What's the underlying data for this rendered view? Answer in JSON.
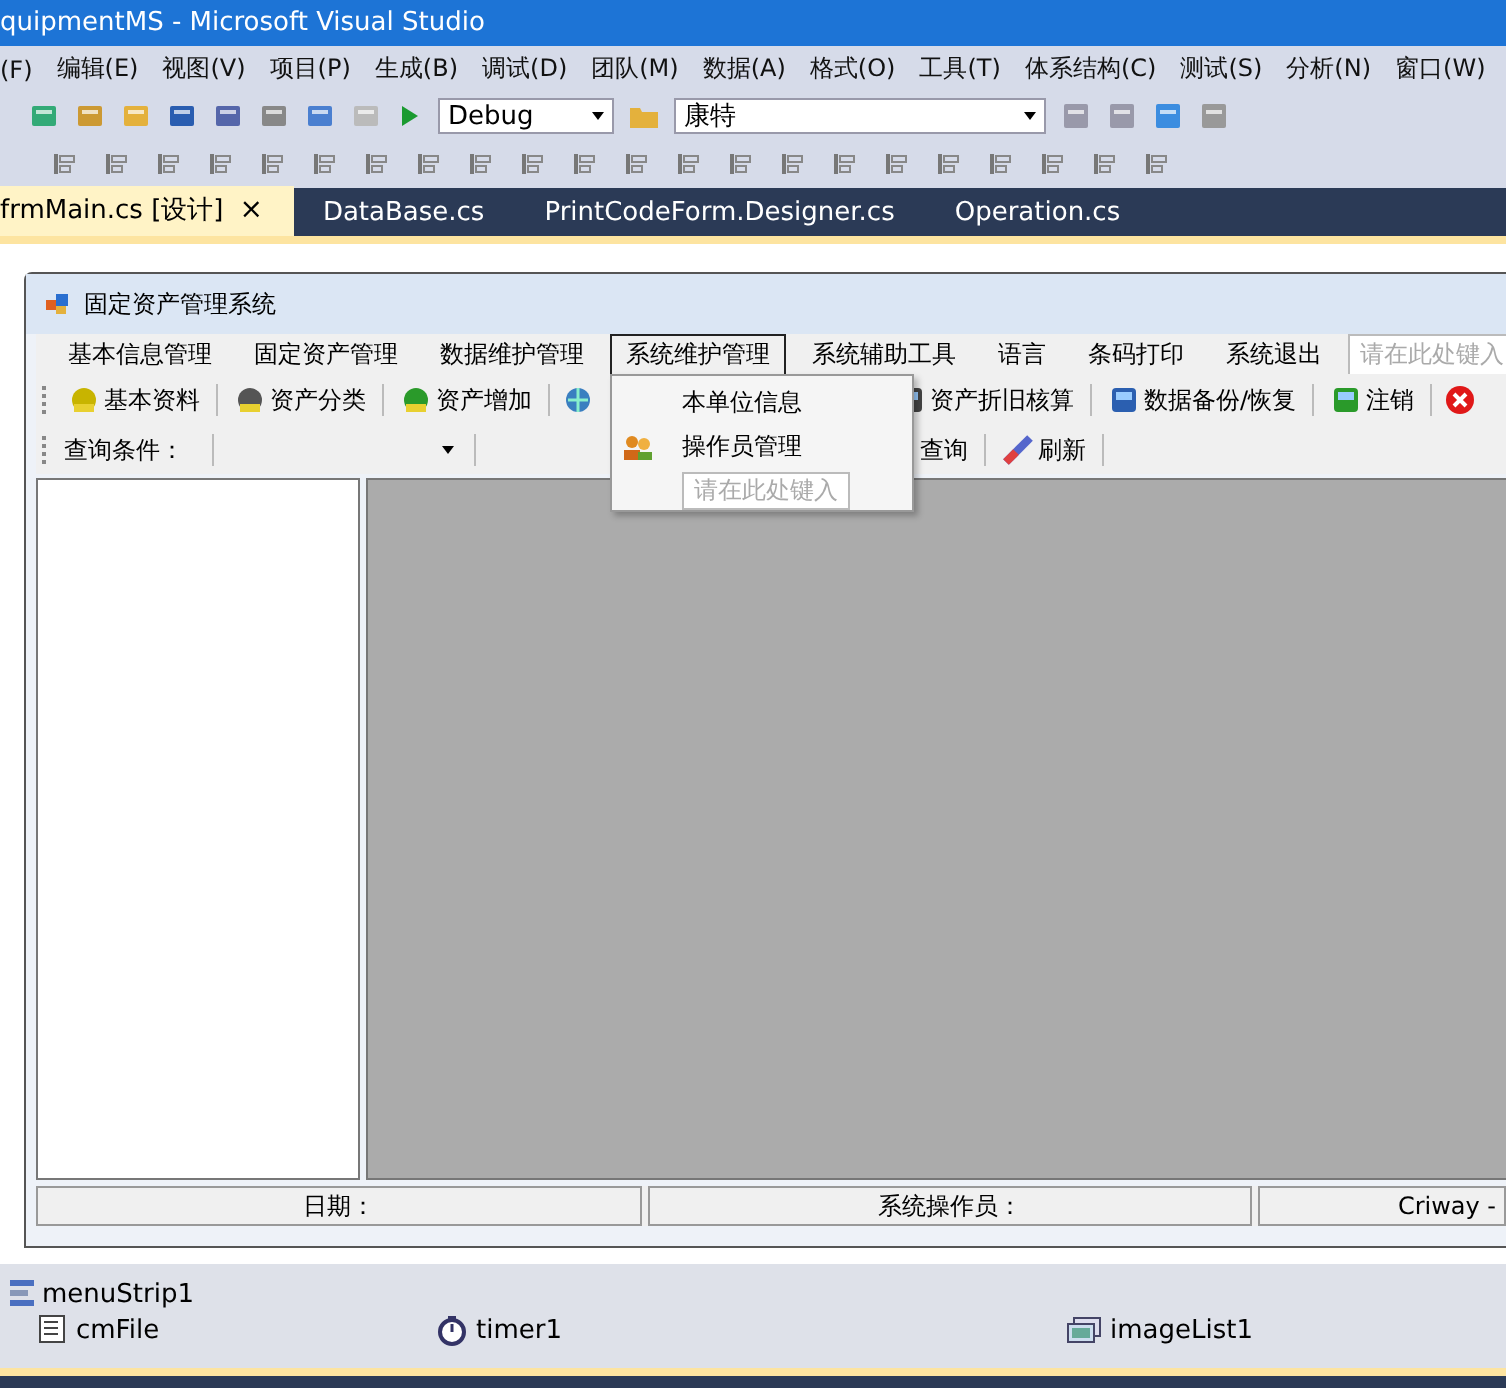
{
  "window": {
    "title": "quipmentMS - Microsoft Visual Studio"
  },
  "menu": [
    "(F)",
    "编辑(E)",
    "视图(V)",
    "项目(P)",
    "生成(B)",
    "调试(D)",
    "团队(M)",
    "数据(A)",
    "格式(O)",
    "工具(T)",
    "体系结构(C)",
    "测试(S)",
    "分析(N)",
    "窗口(W)"
  ],
  "toolbar": {
    "config_combo": "Debug",
    "project_combo": "康特"
  },
  "tabs": [
    {
      "label": "frmMain.cs [设计]",
      "selected": true,
      "close": "×"
    },
    {
      "label": "DataBase.cs",
      "selected": false
    },
    {
      "label": "PrintCodeForm.Designer.cs",
      "selected": false
    },
    {
      "label": "Operation.cs",
      "selected": false
    }
  ],
  "form": {
    "title": "固定资产管理系统",
    "menu": [
      {
        "label": "基本信息管理",
        "selected": false
      },
      {
        "label": "固定资产管理",
        "selected": false
      },
      {
        "label": "数据维护管理",
        "selected": false
      },
      {
        "label": "系统维护管理",
        "selected": true
      },
      {
        "label": "系统辅助工具",
        "selected": false
      },
      {
        "label": "语言",
        "selected": false
      },
      {
        "label": "条码打印",
        "selected": false
      },
      {
        "label": "系统退出",
        "selected": false
      }
    ],
    "menu_placeholder": "请在此处键入",
    "dropdown": [
      {
        "label": "本单位信息",
        "kind": "plain"
      },
      {
        "label": "操作员管理",
        "kind": "icon"
      }
    ],
    "dropdown_placeholder": "请在此处键入",
    "toolbar_left": [
      "基本资料",
      "资产分类",
      "资产增加"
    ],
    "toolbar_right": [
      "资产折旧核算",
      "数据备份/恢复",
      "注销"
    ],
    "query_label": "查询条件：",
    "query_buttons": [
      "查询",
      "刷新"
    ],
    "status": [
      "日期：",
      "系统操作员：",
      "Criway -"
    ]
  },
  "tray": [
    "menuStrip1",
    "cmFile",
    "timer1",
    "imageList1"
  ]
}
